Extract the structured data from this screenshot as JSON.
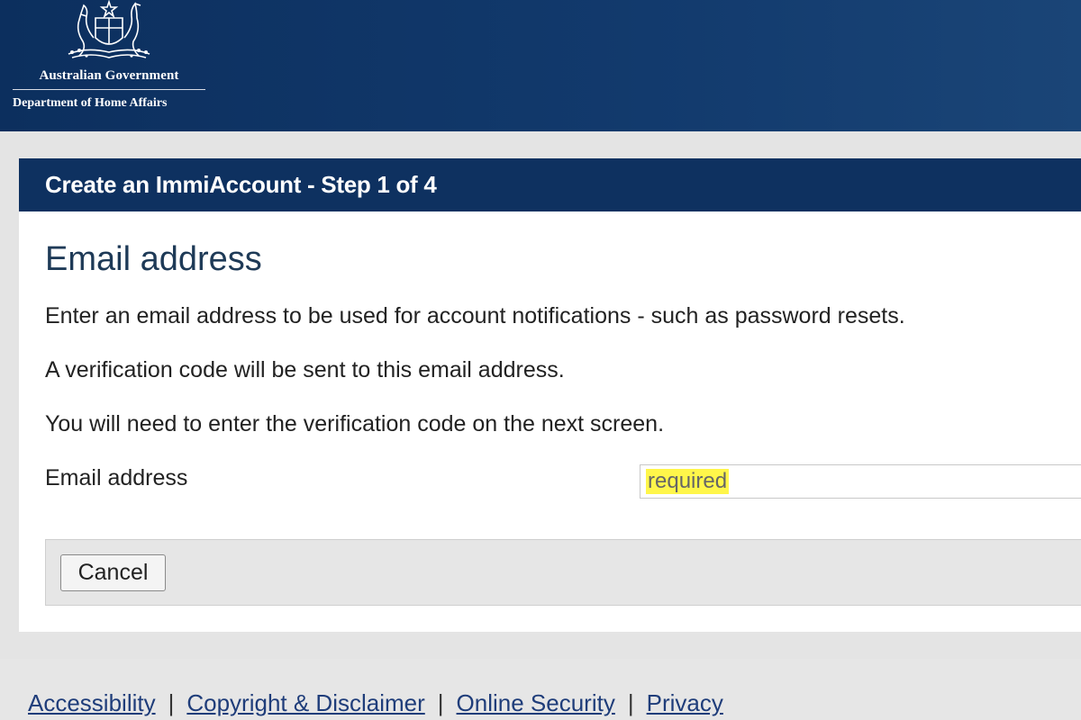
{
  "header": {
    "agency": "Australian Government",
    "department": "Department of Home Affairs",
    "crest_icon": "coat-of-arms-icon"
  },
  "panel": {
    "title": "Create an ImmiAccount - Step 1 of 4",
    "section_title": "Email address",
    "paragraphs": [
      "Enter an email address to be used for account notifications - such as password resets.",
      "A verification code will be sent to this email address.",
      "You will need to enter the verification code on the next screen."
    ],
    "email_field": {
      "label": "Email address",
      "value": "",
      "required_hint": "required"
    },
    "buttons": {
      "cancel_label": "Cancel"
    }
  },
  "footer": {
    "links": [
      "Accessibility",
      "Copyright & Disclaimer",
      "Online Security",
      "Privacy"
    ],
    "separator": "|"
  },
  "colors": {
    "header_bg": "#0c2f5e",
    "panel_header_bg": "#0e3160",
    "highlight": "#fff64a",
    "page_bg": "#e4e4e4"
  }
}
